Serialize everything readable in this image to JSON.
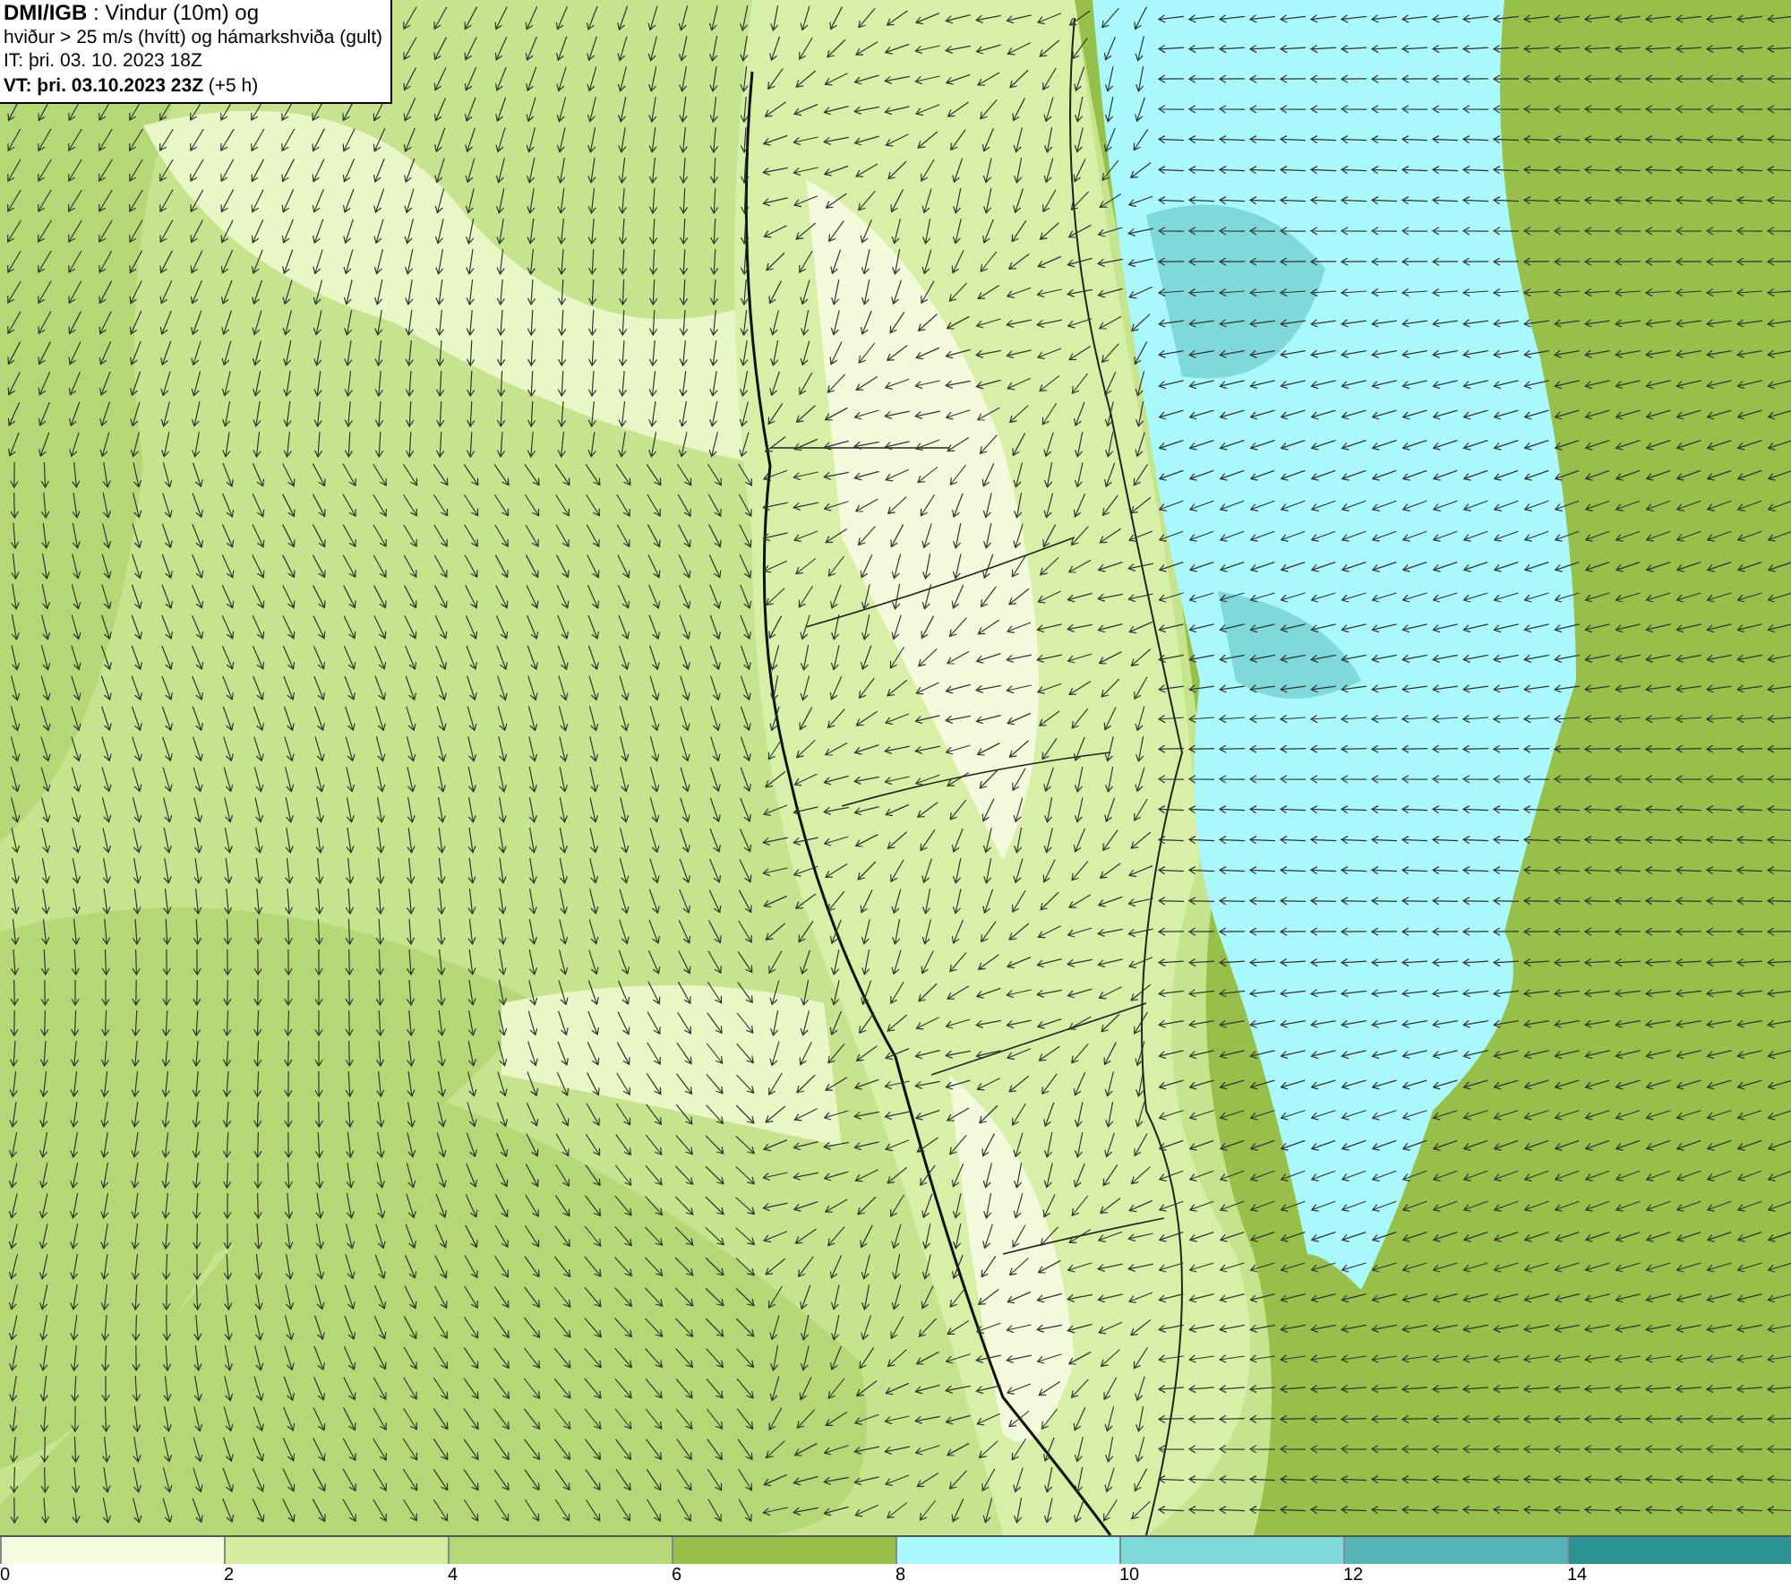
{
  "header": {
    "lines": [
      "**DMI/IGB** : Vindur (10m) og",
      "hviður > 25 m/s (hvítt) og hámarkshviða (gult)",
      "IT: þri. 03. 10. 2023 18Z",
      "**VT: þri. 03.10.2023 23Z** (+5 h)"
    ]
  },
  "legend": {
    "bins": [
      {
        "color": "#f4fbde"
      },
      {
        "color": "#d3eca0"
      },
      {
        "color": "#b4d875"
      },
      {
        "color": "#96c04a"
      },
      {
        "color": "#a9f8fb"
      },
      {
        "color": "#7fd8da"
      },
      {
        "color": "#55b4b6"
      },
      {
        "color": "#2a9294"
      }
    ],
    "ticks": [
      "0",
      "2",
      "4",
      "6",
      "8",
      "10",
      "12",
      "14"
    ]
  }
}
